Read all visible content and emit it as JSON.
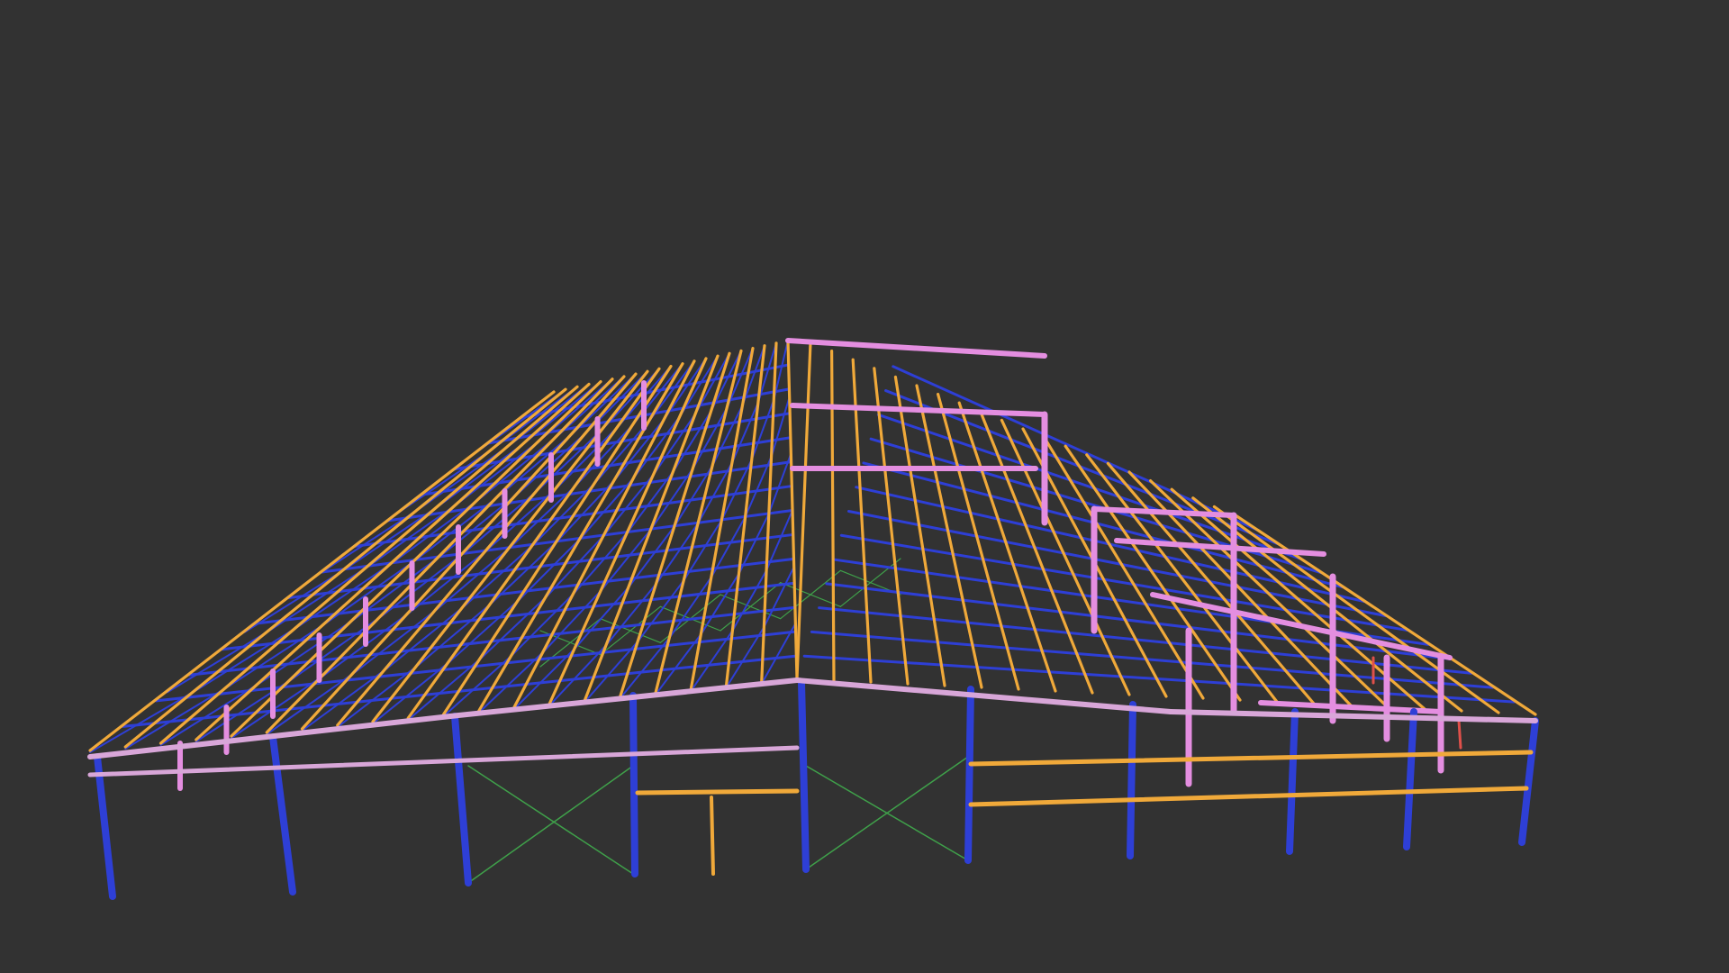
{
  "viewer": {
    "background": "#323232"
  },
  "model": {
    "description_colors": {
      "column": "#2e3fd6",
      "purlin": "#f0a93a",
      "rafter": "#e48ee0",
      "frame_beam": "#d8a6d8",
      "bracing": "#3fa04a",
      "accent_red": "#e0504a"
    }
  }
}
